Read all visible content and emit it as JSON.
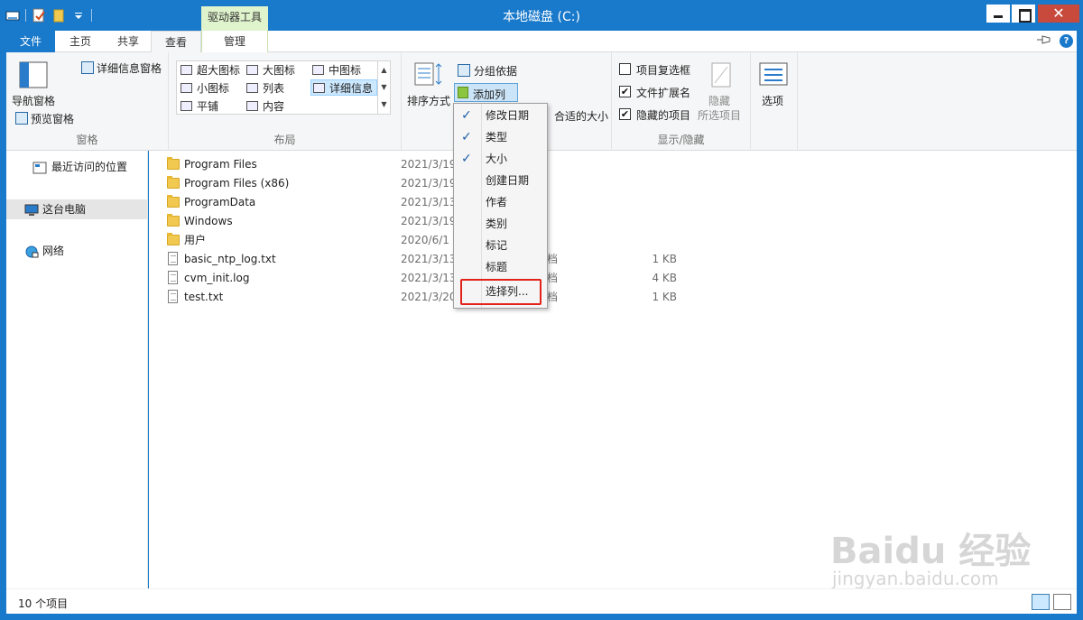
{
  "window": {
    "title": "本地磁盘 (C:)",
    "context_tab_title": "驱动器工具",
    "close_glyph": "✕"
  },
  "tabs": [
    "文件",
    "主页",
    "共享",
    "查看",
    "管理"
  ],
  "help_glyph": "?",
  "ribbon": {
    "panes": {
      "nav_pane": "导航窗格",
      "preview_pane": "预览窗格",
      "details_pane": "详细信息窗格",
      "label": "窗格"
    },
    "layout": {
      "items": [
        "超大图标",
        "大图标",
        "中图标",
        "小图标",
        "列表",
        "详细信息",
        "平铺",
        "内容"
      ],
      "selected": "详细信息",
      "label": "布局",
      "scroll_up": "▲",
      "scroll_down": "▼",
      "scroll_more": "▼"
    },
    "current_view": {
      "sort_by": "排序方式",
      "group_by": "分组依据",
      "add_column": "添加列",
      "size_all_columns_tail": "合适的大小"
    },
    "show_hide": {
      "item_checkboxes": "项目复选框",
      "item_checkboxes_checked": false,
      "file_extensions": "文件扩展名",
      "file_extensions_checked": true,
      "hidden_items": "隐藏的项目",
      "hidden_items_checked": true,
      "hide_selected_line1": "隐藏",
      "hide_selected_line2": "所选项目",
      "label": "显示/隐藏",
      "check_glyph": "✔"
    },
    "options": "选项"
  },
  "nav": {
    "recent": "最近访问的位置",
    "this_pc": "这台电脑",
    "network": "网络"
  },
  "files": [
    {
      "name": "Program Files",
      "date": "2021/3/19",
      "type_tail": "",
      "size": "",
      "kind": "folder"
    },
    {
      "name": "Program Files (x86)",
      "date": "2021/3/19",
      "type_tail": "",
      "size": "",
      "kind": "folder"
    },
    {
      "name": "ProgramData",
      "date": "2021/3/13",
      "type_tail": "",
      "size": "",
      "kind": "folder"
    },
    {
      "name": "Windows",
      "date": "2021/3/19",
      "type_tail": "",
      "size": "",
      "kind": "folder"
    },
    {
      "name": "用户",
      "date": "2020/6/1",
      "type_tail": "",
      "size": "",
      "kind": "folder"
    },
    {
      "name": "basic_ntp_log.txt",
      "date": "2021/3/13",
      "type_tail": "档",
      "size": "1 KB",
      "kind": "file"
    },
    {
      "name": "cvm_init.log",
      "date": "2021/3/13",
      "type_tail": "档",
      "size": "4 KB",
      "kind": "file"
    },
    {
      "name": "test.txt",
      "date": "2021/3/20",
      "type_tail": "档",
      "size": "1 KB",
      "kind": "file"
    }
  ],
  "add_column_menu": [
    {
      "label": "修改日期",
      "checked": true
    },
    {
      "label": "类型",
      "checked": true
    },
    {
      "label": "大小",
      "checked": true
    },
    {
      "label": "创建日期",
      "checked": false
    },
    {
      "label": "作者",
      "checked": false
    },
    {
      "label": "类别",
      "checked": false
    },
    {
      "label": "标记",
      "checked": false
    },
    {
      "label": "标题",
      "checked": false
    },
    {
      "label": "选择列...",
      "checked": false
    }
  ],
  "check_glyph": "✓",
  "status": {
    "item_count": "10 个项目"
  },
  "watermark": {
    "brand": "Baidu 经验",
    "url": "jingyan.baidu.com"
  },
  "colors": {
    "title_bar": "#1979ca",
    "context_tab": "#dff3cc",
    "selected": "#cce8ff",
    "highlight_box": "#e2231a"
  }
}
